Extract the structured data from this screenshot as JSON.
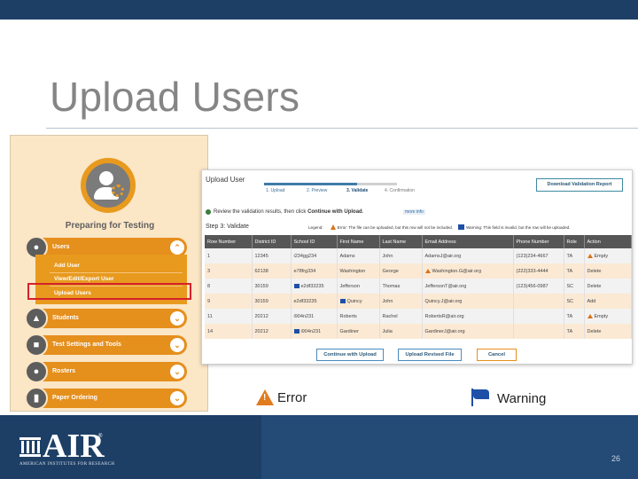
{
  "slide": {
    "title": "Upload Users",
    "page_number": "26"
  },
  "sidebar": {
    "heading": "Preparing for Testing",
    "nav": [
      {
        "label": "Users",
        "icon": "users-icon",
        "expanded": true
      },
      {
        "label": "Students",
        "icon": "graduation-cap-icon",
        "expanded": false
      },
      {
        "label": "Test Settings and Tools",
        "icon": "settings-tools-icon",
        "expanded": false
      },
      {
        "label": "Rosters",
        "icon": "roster-icon",
        "expanded": false
      },
      {
        "label": "Paper Ordering",
        "icon": "paper-icon",
        "expanded": false
      }
    ],
    "submenu": [
      {
        "label": "Add User"
      },
      {
        "label": "View/Edit/Export User"
      },
      {
        "label": "Upload Users",
        "highlighted": true
      }
    ]
  },
  "panel": {
    "title": "Upload User",
    "steps": [
      "1. Upload",
      "2. Preview",
      "3. Validate",
      "4. Confirmation"
    ],
    "current_step": 3,
    "download_button": "Download Validation Report",
    "info_prefix": "Review the validation results, then click ",
    "info_bold": "Continue with Upload",
    "info_suffix": ".",
    "info_more": "more info",
    "step_heading": "Step 3: Validate",
    "legend_label": "Legend:",
    "legend_error": "Error: The file can be uploaded, but this row will not be included.",
    "legend_warning": "Warning: This field is invalid, but the row will be uploaded.",
    "columns": [
      "Row Number",
      "District ID",
      "School ID",
      "First Name",
      "Last Name",
      "Email Address",
      "Phone Number",
      "Role",
      "Action"
    ],
    "rows": [
      {
        "cells": [
          "1",
          "12345",
          "i234gg234",
          "Adams",
          "John",
          "AdamsJ@air.org",
          "(123)234-4667",
          "TA",
          "Empty"
        ],
        "flag": {
          "col": 8,
          "type": "error"
        }
      },
      {
        "cells": [
          "3",
          "62138",
          "e78frg334",
          "Washington",
          "George",
          "Washington.G@air.org",
          "(222)333-4444",
          "TA",
          "Delete"
        ],
        "flag": {
          "col": 5,
          "type": "error"
        }
      },
      {
        "cells": [
          "8",
          "30159",
          "e2df33235",
          "Jefferson",
          "Thomas",
          "JeffersonT@air.org",
          "(123)456-0987",
          "SC",
          "Delete"
        ],
        "flag": {
          "col": 2,
          "type": "warning"
        }
      },
      {
        "cells": [
          "9",
          "30159",
          "e2df33235",
          "Quincy",
          "John",
          "Quincy.J@air.org",
          "",
          "SC",
          "Add"
        ],
        "flag": {
          "col": 3,
          "type": "warning"
        }
      },
      {
        "cells": [
          "11",
          "20212",
          "i904n231",
          "Roberts",
          "Rachel",
          "RobertsR@air.org",
          "",
          "TA",
          "Empty"
        ],
        "flag": {
          "col": 8,
          "type": "error"
        }
      },
      {
        "cells": [
          "14",
          "20212",
          "i904n231",
          "Gardiner",
          "Julia",
          "GardinerJ@air.org",
          "",
          "TA",
          "Delete"
        ],
        "flag": {
          "col": 2,
          "type": "warning"
        }
      }
    ],
    "buttons": {
      "continue": "Continue with Upload",
      "revised": "Upload Revised File",
      "cancel": "Cancel"
    }
  },
  "legend_below": {
    "error": "Error",
    "warning": "Warning"
  },
  "footer": {
    "logo_text": "AIR",
    "registered": "®",
    "logo_subtitle": "AMERICAN INSTITUTES FOR RESEARCH"
  },
  "colors": {
    "navy": "#1d3f66",
    "orange": "#e58f1d",
    "sidebar_bg": "#fbe6c6",
    "highlight_red": "#d4212b",
    "warning_blue": "#1d4fa6"
  }
}
